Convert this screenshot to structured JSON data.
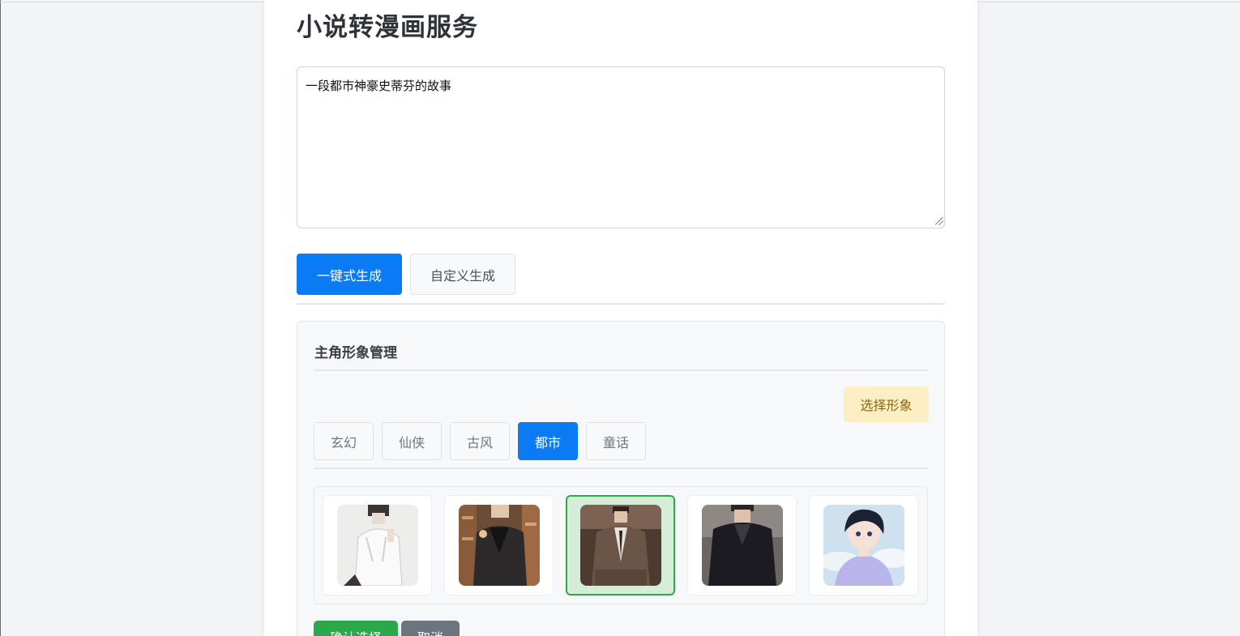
{
  "page": {
    "title": "小说转漫画服务"
  },
  "story": {
    "value": "一段都市神豪史蒂芬的故事"
  },
  "tabs": [
    {
      "label": "一键式生成",
      "active": true
    },
    {
      "label": "自定义生成",
      "active": false
    }
  ],
  "character_panel": {
    "title": "主角形象管理",
    "select_button": "选择形象",
    "categories": [
      {
        "label": "玄幻",
        "active": false
      },
      {
        "label": "仙侠",
        "active": false
      },
      {
        "label": "古风",
        "active": false
      },
      {
        "label": "都市",
        "active": true
      },
      {
        "label": "童话",
        "active": false
      }
    ],
    "selected_index": 2,
    "confirm_button": "确认选择",
    "cancel_button": "取消"
  },
  "colors": {
    "primary": "#0a7bf5",
    "success": "#2ba84a",
    "warning_bg": "#fdefc3",
    "secondary": "#6c757d"
  }
}
